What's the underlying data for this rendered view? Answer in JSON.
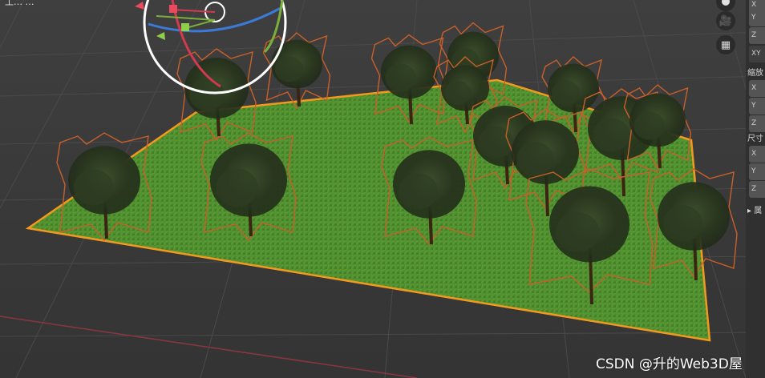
{
  "header": {
    "clipped_text": "工… …"
  },
  "nav_buttons": [
    {
      "name": "camera-icon",
      "glyph": "🎥"
    },
    {
      "name": "grid-icon",
      "glyph": "▦"
    }
  ],
  "side_panel": {
    "location_axes": [
      "X",
      "Y",
      "Z"
    ],
    "rotation_mode": "XY",
    "scale_label": "缩放",
    "scale_axes": [
      "X",
      "Y",
      "Z"
    ],
    "dimensions_label": "尺寸",
    "dimensions_axes": [
      "X",
      "Y",
      "Z"
    ],
    "collapsed_section": "▸ 属"
  },
  "scene": {
    "ground_color": "#4d8a2e",
    "selection_color": "#f39a1e",
    "tree_outline_color": "#c8602a",
    "tree_canopy_color": "#2e3d22",
    "trunk_color": "#3a2412",
    "axis_x_color": "#d23a4f",
    "axis_y_color": "#7ab03a",
    "axis_z_color": "#3c7ad8"
  },
  "watermark": "CSDN @升的Web3D屋"
}
